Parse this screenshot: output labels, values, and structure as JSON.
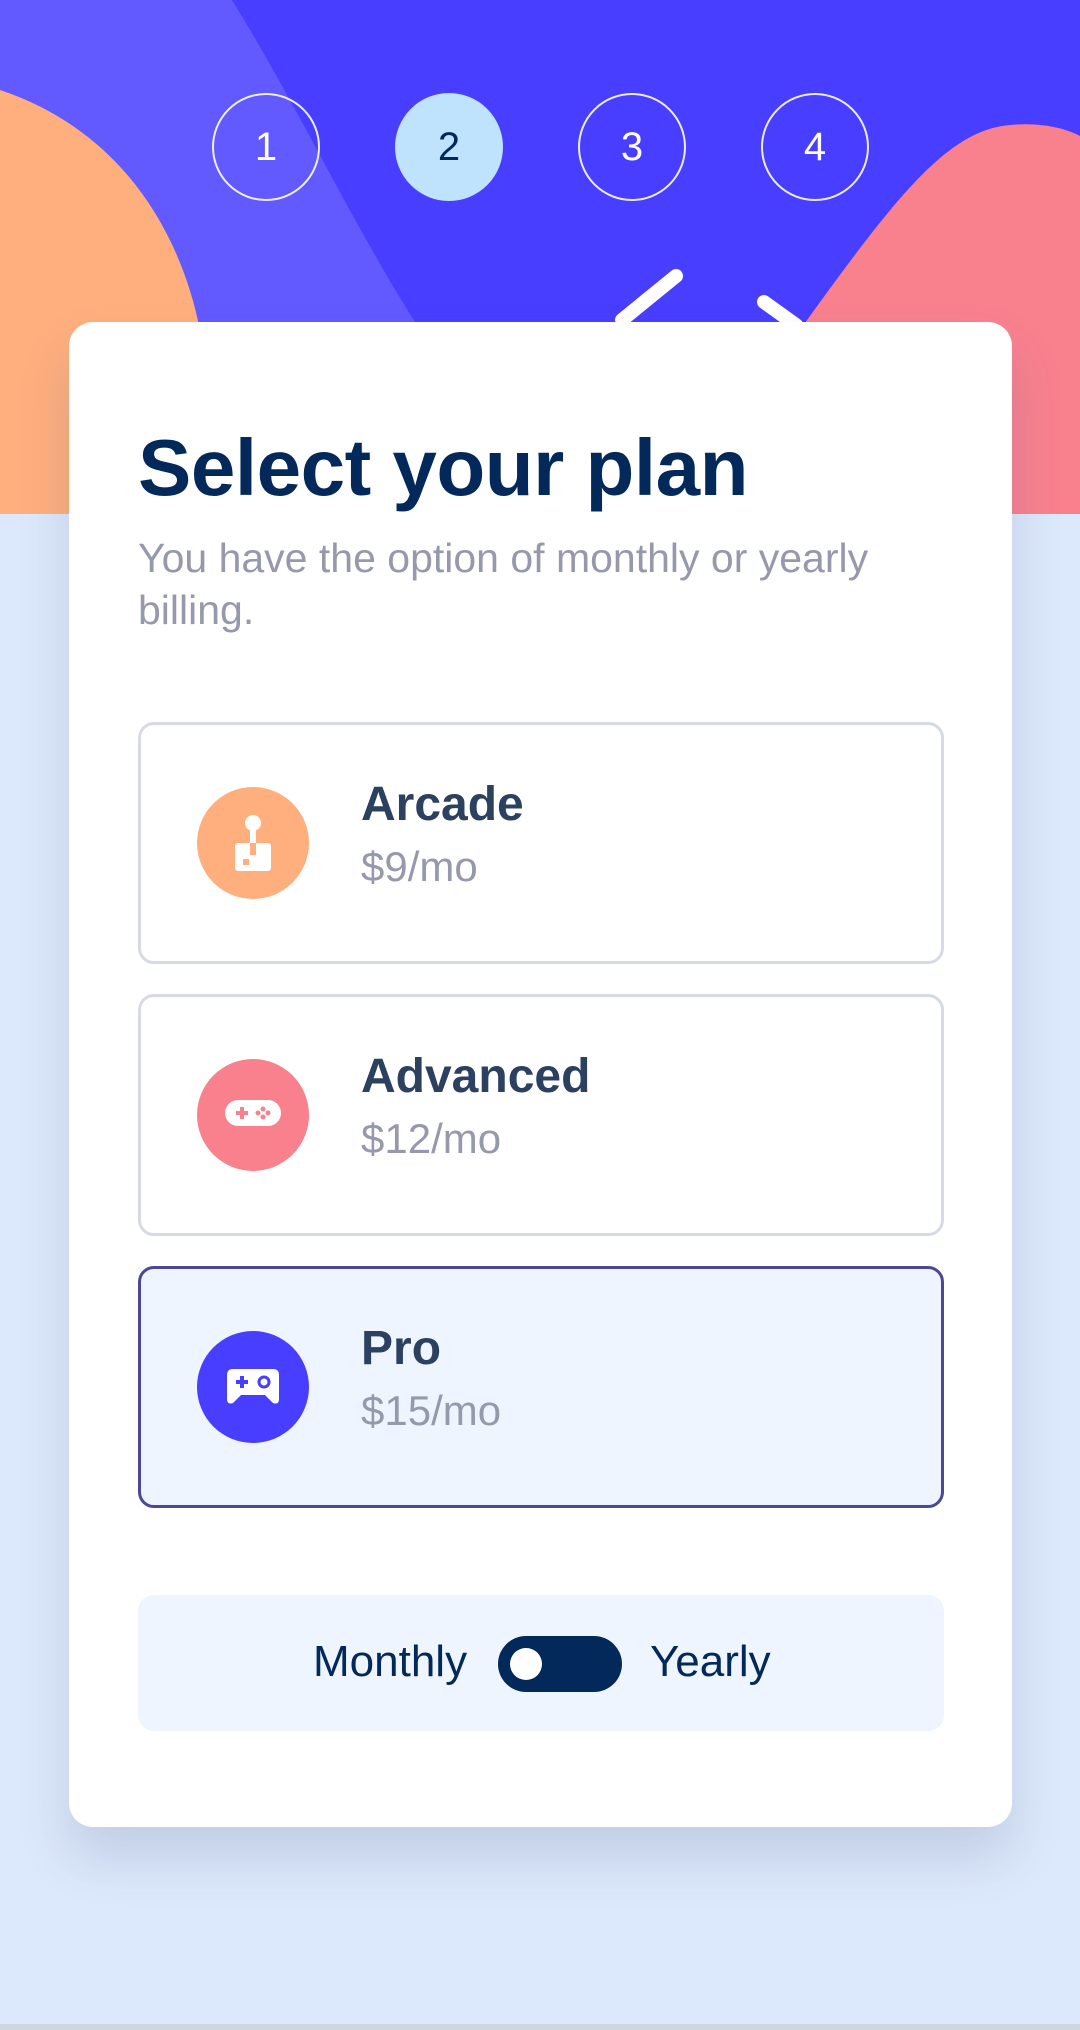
{
  "steps": [
    {
      "number": "1",
      "active": false
    },
    {
      "number": "2",
      "active": true
    },
    {
      "number": "3",
      "active": false
    },
    {
      "number": "4",
      "active": false
    }
  ],
  "header": {
    "title": "Select your plan",
    "subtitle": "You have the option of monthly or yearly billing."
  },
  "plans": [
    {
      "name": "Arcade",
      "price": "$9/mo",
      "icon": "arcade-joystick-icon",
      "color": "#ffaf7e",
      "selected": false
    },
    {
      "name": "Advanced",
      "price": "$12/mo",
      "icon": "gamepad-icon",
      "color": "#f9818e",
      "selected": false
    },
    {
      "name": "Pro",
      "price": "$15/mo",
      "icon": "game-controller-icon",
      "color": "#483eff",
      "selected": true
    }
  ],
  "billing": {
    "monthly_label": "Monthly",
    "yearly_label": "Yearly",
    "selected": "Monthly"
  },
  "colors": {
    "background": "#dce8fb",
    "hero_primary": "#483eff",
    "accent_orange": "#ffaf7e",
    "accent_pink": "#f9818e",
    "marine_blue": "#02295a",
    "active_step": "#bfe2fd",
    "selected_border": "#4d4798"
  }
}
